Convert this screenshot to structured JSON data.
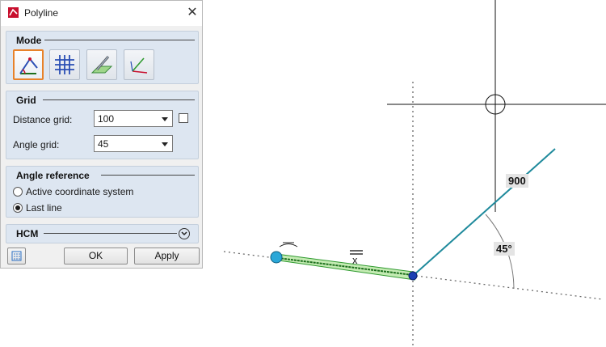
{
  "dialog": {
    "title": "Polyline",
    "close_glyph": "✕",
    "mode": {
      "title": "Mode",
      "buttons": [
        {
          "icon": "polyline-angle-icon",
          "active": true
        },
        {
          "icon": "grid-icon",
          "active": false
        },
        {
          "icon": "sketch-plane-icon",
          "active": false
        },
        {
          "icon": "coordinate-axes-icon",
          "active": false
        }
      ]
    },
    "grid": {
      "title": "Grid",
      "distance_label": "Distance grid:",
      "distance_value": "100",
      "angle_label": "Angle grid:",
      "angle_value": "45"
    },
    "angle_reference": {
      "title": "Angle reference",
      "options": [
        "Active coordinate system",
        "Last line"
      ],
      "selected": "Last line"
    },
    "hcm": {
      "title": "HCM"
    },
    "ok_label": "OK",
    "apply_label": "Apply"
  },
  "viewport": {
    "length_label": "900",
    "angle_label": "45°",
    "x_marker": "x",
    "colors": {
      "line": "#1f8a9c",
      "segment_fill": "#b7e4a3",
      "segment_border": "#2f9a2f",
      "point_start": "#2aa7d8",
      "point_end": "#1b3fb3"
    }
  }
}
